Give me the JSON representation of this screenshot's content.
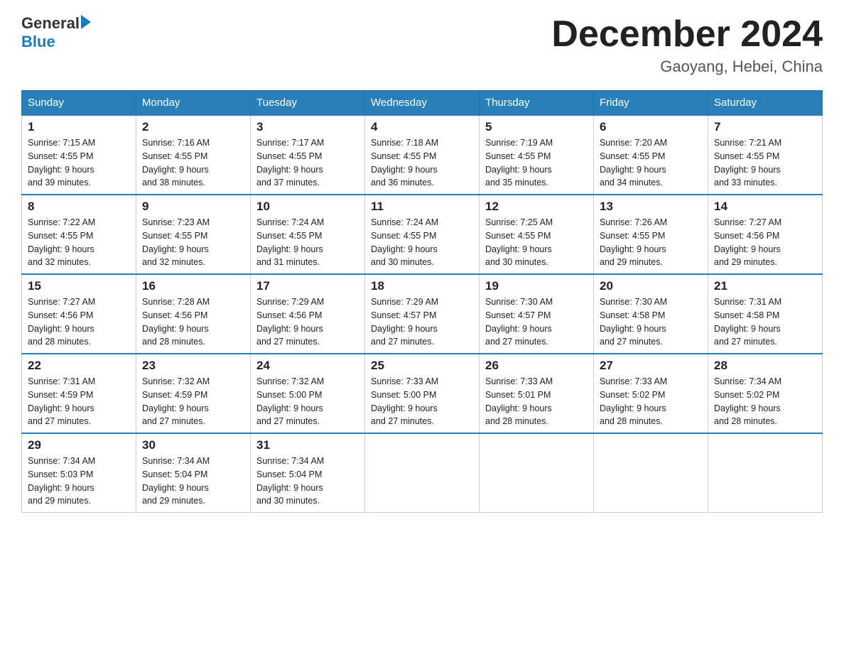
{
  "header": {
    "logo_general": "General",
    "logo_blue": "Blue",
    "month_title": "December 2024",
    "location": "Gaoyang, Hebei, China"
  },
  "weekdays": [
    "Sunday",
    "Monday",
    "Tuesday",
    "Wednesday",
    "Thursday",
    "Friday",
    "Saturday"
  ],
  "weeks": [
    [
      {
        "day": "1",
        "sunrise": "7:15 AM",
        "sunset": "4:55 PM",
        "daylight": "9 hours and 39 minutes."
      },
      {
        "day": "2",
        "sunrise": "7:16 AM",
        "sunset": "4:55 PM",
        "daylight": "9 hours and 38 minutes."
      },
      {
        "day": "3",
        "sunrise": "7:17 AM",
        "sunset": "4:55 PM",
        "daylight": "9 hours and 37 minutes."
      },
      {
        "day": "4",
        "sunrise": "7:18 AM",
        "sunset": "4:55 PM",
        "daylight": "9 hours and 36 minutes."
      },
      {
        "day": "5",
        "sunrise": "7:19 AM",
        "sunset": "4:55 PM",
        "daylight": "9 hours and 35 minutes."
      },
      {
        "day": "6",
        "sunrise": "7:20 AM",
        "sunset": "4:55 PM",
        "daylight": "9 hours and 34 minutes."
      },
      {
        "day": "7",
        "sunrise": "7:21 AM",
        "sunset": "4:55 PM",
        "daylight": "9 hours and 33 minutes."
      }
    ],
    [
      {
        "day": "8",
        "sunrise": "7:22 AM",
        "sunset": "4:55 PM",
        "daylight": "9 hours and 32 minutes."
      },
      {
        "day": "9",
        "sunrise": "7:23 AM",
        "sunset": "4:55 PM",
        "daylight": "9 hours and 32 minutes."
      },
      {
        "day": "10",
        "sunrise": "7:24 AM",
        "sunset": "4:55 PM",
        "daylight": "9 hours and 31 minutes."
      },
      {
        "day": "11",
        "sunrise": "7:24 AM",
        "sunset": "4:55 PM",
        "daylight": "9 hours and 30 minutes."
      },
      {
        "day": "12",
        "sunrise": "7:25 AM",
        "sunset": "4:55 PM",
        "daylight": "9 hours and 30 minutes."
      },
      {
        "day": "13",
        "sunrise": "7:26 AM",
        "sunset": "4:55 PM",
        "daylight": "9 hours and 29 minutes."
      },
      {
        "day": "14",
        "sunrise": "7:27 AM",
        "sunset": "4:56 PM",
        "daylight": "9 hours and 29 minutes."
      }
    ],
    [
      {
        "day": "15",
        "sunrise": "7:27 AM",
        "sunset": "4:56 PM",
        "daylight": "9 hours and 28 minutes."
      },
      {
        "day": "16",
        "sunrise": "7:28 AM",
        "sunset": "4:56 PM",
        "daylight": "9 hours and 28 minutes."
      },
      {
        "day": "17",
        "sunrise": "7:29 AM",
        "sunset": "4:56 PM",
        "daylight": "9 hours and 27 minutes."
      },
      {
        "day": "18",
        "sunrise": "7:29 AM",
        "sunset": "4:57 PM",
        "daylight": "9 hours and 27 minutes."
      },
      {
        "day": "19",
        "sunrise": "7:30 AM",
        "sunset": "4:57 PM",
        "daylight": "9 hours and 27 minutes."
      },
      {
        "day": "20",
        "sunrise": "7:30 AM",
        "sunset": "4:58 PM",
        "daylight": "9 hours and 27 minutes."
      },
      {
        "day": "21",
        "sunrise": "7:31 AM",
        "sunset": "4:58 PM",
        "daylight": "9 hours and 27 minutes."
      }
    ],
    [
      {
        "day": "22",
        "sunrise": "7:31 AM",
        "sunset": "4:59 PM",
        "daylight": "9 hours and 27 minutes."
      },
      {
        "day": "23",
        "sunrise": "7:32 AM",
        "sunset": "4:59 PM",
        "daylight": "9 hours and 27 minutes."
      },
      {
        "day": "24",
        "sunrise": "7:32 AM",
        "sunset": "5:00 PM",
        "daylight": "9 hours and 27 minutes."
      },
      {
        "day": "25",
        "sunrise": "7:33 AM",
        "sunset": "5:00 PM",
        "daylight": "9 hours and 27 minutes."
      },
      {
        "day": "26",
        "sunrise": "7:33 AM",
        "sunset": "5:01 PM",
        "daylight": "9 hours and 28 minutes."
      },
      {
        "day": "27",
        "sunrise": "7:33 AM",
        "sunset": "5:02 PM",
        "daylight": "9 hours and 28 minutes."
      },
      {
        "day": "28",
        "sunrise": "7:34 AM",
        "sunset": "5:02 PM",
        "daylight": "9 hours and 28 minutes."
      }
    ],
    [
      {
        "day": "29",
        "sunrise": "7:34 AM",
        "sunset": "5:03 PM",
        "daylight": "9 hours and 29 minutes."
      },
      {
        "day": "30",
        "sunrise": "7:34 AM",
        "sunset": "5:04 PM",
        "daylight": "9 hours and 29 minutes."
      },
      {
        "day": "31",
        "sunrise": "7:34 AM",
        "sunset": "5:04 PM",
        "daylight": "9 hours and 30 minutes."
      },
      {
        "day": "",
        "sunrise": "",
        "sunset": "",
        "daylight": ""
      },
      {
        "day": "",
        "sunrise": "",
        "sunset": "",
        "daylight": ""
      },
      {
        "day": "",
        "sunrise": "",
        "sunset": "",
        "daylight": ""
      },
      {
        "day": "",
        "sunrise": "",
        "sunset": "",
        "daylight": ""
      }
    ]
  ],
  "labels": {
    "sunrise": "Sunrise: ",
    "sunset": "Sunset: ",
    "daylight": "Daylight: "
  }
}
